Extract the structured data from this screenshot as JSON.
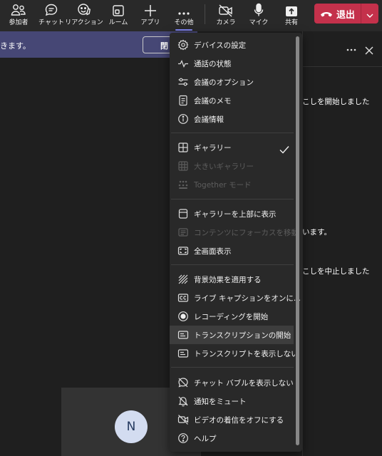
{
  "toolbar": {
    "items": [
      {
        "label": "参加者",
        "icon": "people-icon"
      },
      {
        "label": "チャット",
        "icon": "chat-icon"
      },
      {
        "label": "リアクション",
        "icon": "reaction-icon"
      },
      {
        "label": "ルーム",
        "icon": "room-icon"
      },
      {
        "label": "アプリ",
        "icon": "plus-icon"
      },
      {
        "label": "その他",
        "icon": "more-icon"
      },
      {
        "label": "カメラ",
        "icon": "camera-off-icon"
      },
      {
        "label": "マイク",
        "icon": "mic-icon"
      },
      {
        "label": "共有",
        "icon": "share-icon"
      }
    ],
    "leave_label": "退出"
  },
  "banner": {
    "text": "きます。",
    "button_label": "閉"
  },
  "right_panel": {
    "lines": [
      "こしを開始しました",
      "います。",
      "こしを中止しました"
    ]
  },
  "participant": {
    "initial": "N"
  },
  "menu": {
    "items": [
      {
        "label": "デバイスの設定",
        "icon": "gear-icon",
        "enabled": true
      },
      {
        "label": "通話の状態",
        "icon": "pulse-icon",
        "enabled": true
      },
      {
        "label": "会議のオプション",
        "icon": "options-icon",
        "enabled": true
      },
      {
        "label": "会議のメモ",
        "icon": "notes-icon",
        "enabled": true
      },
      {
        "label": "会議情報",
        "icon": "info-icon",
        "enabled": true
      },
      {
        "label": "ギャラリー",
        "icon": "gallery-icon",
        "enabled": true,
        "checked": true
      },
      {
        "label": "大きいギャラリー",
        "icon": "large-gallery-icon",
        "enabled": false
      },
      {
        "label": "Together モード",
        "icon": "together-mode-icon",
        "enabled": false
      },
      {
        "label": "ギャラリーを上部に表示",
        "icon": "gallery-top-icon",
        "enabled": true
      },
      {
        "label": "コンテンツにフォーカスを移動",
        "icon": "focus-icon",
        "enabled": false
      },
      {
        "label": "全画面表示",
        "icon": "fullscreen-icon",
        "enabled": true
      },
      {
        "label": "背景効果を適用する",
        "icon": "background-effects-icon",
        "enabled": true
      },
      {
        "label": "ライブ キャプションをオンに...",
        "icon": "captions-icon",
        "enabled": true
      },
      {
        "label": "レコーディングを開始",
        "icon": "record-icon",
        "enabled": true
      },
      {
        "label": "トランスクリプションの開始",
        "icon": "transcript-icon",
        "enabled": true,
        "highlighted": true
      },
      {
        "label": "トランスクリプトを表示しない",
        "icon": "transcript-hide-icon",
        "enabled": true
      },
      {
        "label": "チャット バブルを表示しない",
        "icon": "chat-bubble-off-icon",
        "enabled": true
      },
      {
        "label": "通知をミュート",
        "icon": "bell-off-icon",
        "enabled": true
      },
      {
        "label": "ビデオの着信をオフにする",
        "icon": "video-off-icon",
        "enabled": true
      },
      {
        "label": "ヘルプ",
        "icon": "help-icon",
        "enabled": true
      }
    ]
  },
  "colors": {
    "accent": "#7f85f5",
    "leave": "#c4314b",
    "banner": "#464775",
    "menu_bg": "#292929",
    "toolbar_bg": "#292929"
  }
}
